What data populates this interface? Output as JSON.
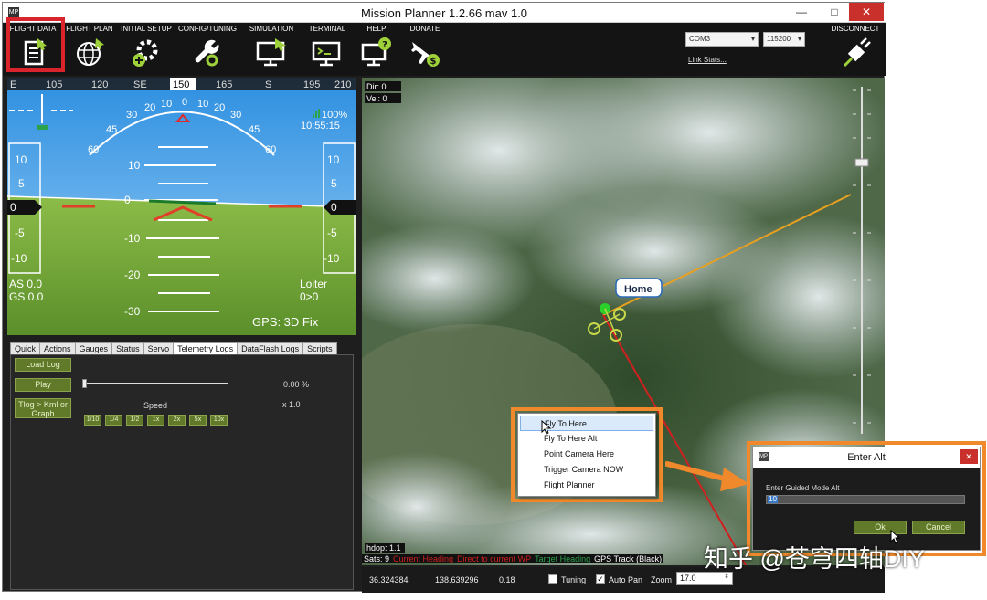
{
  "window": {
    "title": "Mission Planner 1.2.66 mav 1.0",
    "app_icon_text": "MP",
    "minimize": "—",
    "maximize": "□",
    "close": "✕"
  },
  "menu": {
    "items": [
      {
        "label": "FLIGHT DATA",
        "icon": "flight-data-icon"
      },
      {
        "label": "FLIGHT PLAN",
        "icon": "flight-plan-icon"
      },
      {
        "label": "INITIAL SETUP",
        "icon": "initial-setup-icon"
      },
      {
        "label": "CONFIG/TUNING",
        "icon": "config-tuning-icon"
      },
      {
        "label": "SIMULATION",
        "icon": "simulation-icon"
      },
      {
        "label": "TERMINAL",
        "icon": "terminal-icon"
      },
      {
        "label": "HELP",
        "icon": "help-icon"
      },
      {
        "label": "DONATE",
        "icon": "donate-icon"
      }
    ],
    "port": "COM3",
    "baud": "115200",
    "link_stats": "Link Stats...",
    "disconnect": "DISCONNECT"
  },
  "hud": {
    "heading_ticks": [
      "E",
      "105",
      "120",
      "SE",
      "150",
      "165",
      "S",
      "195",
      "210"
    ],
    "heading_value": "150",
    "pitch_labels_up": [
      "10",
      "5"
    ],
    "pitch_labels_down": [
      "-5",
      "-10"
    ],
    "pitch_ladder": [
      "10",
      "0",
      "-10",
      "-20",
      "-30"
    ],
    "roll_scale": [
      "60",
      "45",
      "30",
      "20",
      "10",
      "0",
      "10",
      "20",
      "30",
      "45",
      "60"
    ],
    "left_box": "0",
    "right_box": "0",
    "battery": "100%",
    "time": "10:55:15",
    "airspeed": "AS 0.0",
    "groundspeed": "GS 0.0",
    "mode": "Loiter",
    "wp": "0>0",
    "gps": "GPS: 3D Fix"
  },
  "tabs": [
    "Quick",
    "Actions",
    "Gauges",
    "Status",
    "Servo",
    "Telemetry Logs",
    "DataFlash Logs",
    "Scripts"
  ],
  "active_tab": "Telemetry Logs",
  "telemetry": {
    "load_log": "Load Log",
    "play": "Play",
    "tlog_kml": "Tlog > Kml or Graph",
    "percent": "0.00 %",
    "speed_label": "Speed",
    "speed_value": "x 1.0",
    "speeds": [
      "1/10",
      "1/4",
      "1/2",
      "1x",
      "2x",
      "5x",
      "10x"
    ]
  },
  "map": {
    "dir": "Dir: 0",
    "vel": "Vel: 0",
    "home": "Home",
    "hdop": "hdop: 1.1",
    "status": {
      "sats": "Sats: 9",
      "current_heading": "Current Heading",
      "direct_to_wp": "Direct to current WP",
      "target_heading": "Target Heading",
      "gps_track": "GPS Track (Black)"
    },
    "lat": "36.324384",
    "lng": "138.639296",
    "alt": "0.18",
    "tuning": "Tuning",
    "autopan": "Auto Pan",
    "zoom_label": "Zoom",
    "zoom_value": "17.0"
  },
  "context_menu": [
    "Fly To Here",
    "Fly To Here Alt",
    "Point Camera Here",
    "Trigger Camera NOW",
    "Flight Planner"
  ],
  "dialog": {
    "title": "Enter Alt",
    "prompt": "Enter Guided Mode Alt",
    "value": "10",
    "ok": "Ok",
    "cancel": "Cancel"
  },
  "watermark": "知乎 @苍穹四轴DIY",
  "colors": {
    "menu_bg": "#141414",
    "sky": "#4aa8e8",
    "ground": "#77a83c",
    "button_green": "#607a2a",
    "highlight_orange": "#f0892b"
  }
}
